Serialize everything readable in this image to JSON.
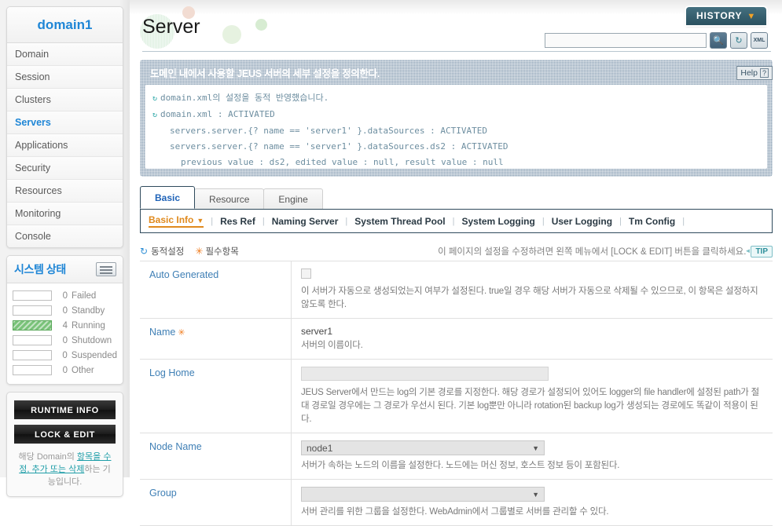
{
  "sidebar": {
    "domain_title": "domain1",
    "nav_items": [
      {
        "label": "Domain",
        "active": false
      },
      {
        "label": "Session",
        "active": false
      },
      {
        "label": "Clusters",
        "active": false
      },
      {
        "label": "Servers",
        "active": true
      },
      {
        "label": "Applications",
        "active": false
      },
      {
        "label": "Security",
        "active": false
      },
      {
        "label": "Resources",
        "active": false
      },
      {
        "label": "Monitoring",
        "active": false
      },
      {
        "label": "Console",
        "active": false
      }
    ],
    "status": {
      "title": "시스템 상태",
      "icon": "monitor-icon",
      "rows": [
        {
          "count": "0",
          "label": "Failed",
          "filled": false
        },
        {
          "count": "0",
          "label": "Standby",
          "filled": false
        },
        {
          "count": "4",
          "label": "Running",
          "filled": true
        },
        {
          "count": "0",
          "label": "Shutdown",
          "filled": false
        },
        {
          "count": "0",
          "label": "Suspended",
          "filled": false
        },
        {
          "count": "0",
          "label": "Other",
          "filled": false
        }
      ],
      "fill_color": "#79c279"
    },
    "buttons": {
      "runtime_info": "RUNTIME INFO",
      "lock_and_edit": "LOCK & EDIT"
    },
    "hint_prefix": "해당 Domain의 ",
    "hint_link": "항목을 수정, 추가 또는 삭제",
    "hint_suffix": "하는 기능입니다."
  },
  "header": {
    "page_title": "Server",
    "history_label": "HISTORY",
    "history_caret": "▼",
    "search_value": "",
    "search_placeholder": "",
    "icons": [
      "search-icon",
      "sync-icon",
      "xml-export-icon"
    ],
    "xml_icon_text": "XML"
  },
  "message_panel": {
    "title": "도메인 내에서 사용할 JEUS 서버의 세부 설정을 정의한다.",
    "help_label": "Help",
    "help_mark": "?",
    "lines": [
      {
        "icon": "sync-icon",
        "text": "domain.xml의 설정을 동적 반영했습니다.",
        "indent": 0
      },
      {
        "icon": "sync-icon",
        "text": "domain.xml : ACTIVATED",
        "indent": 0
      },
      {
        "icon": "",
        "text": "servers.server.{? name == 'server1' }.dataSources : ACTIVATED",
        "indent": 1
      },
      {
        "icon": "",
        "text": "servers.server.{? name == 'server1' }.dataSources.ds2 : ACTIVATED",
        "indent": 1
      },
      {
        "icon": "",
        "text": "previous value : ds2, edited value : null, result value : null",
        "indent": 2
      }
    ]
  },
  "tabs": {
    "main": [
      {
        "label": "Basic",
        "active": true
      },
      {
        "label": "Resource",
        "active": false
      },
      {
        "label": "Engine",
        "active": false
      }
    ],
    "sub": [
      {
        "label": "Basic Info",
        "active": true,
        "caret": "▼"
      },
      {
        "label": "Res Ref",
        "active": false
      },
      {
        "label": "Naming Server",
        "active": false
      },
      {
        "label": "System Thread Pool",
        "active": false
      },
      {
        "label": "System Logging",
        "active": false
      },
      {
        "label": "User Logging",
        "active": false
      },
      {
        "label": "Tm Config",
        "active": false
      }
    ]
  },
  "legend": {
    "dynamic_icon": "sync-icon",
    "dynamic_label": "동적설정",
    "required_icon": "asterisk-icon",
    "required_label": "필수항목",
    "note": "이 페이지의 설정을 수정하려면 왼쪽 메뉴에서 [LOCK & EDIT] 버튼을 클릭하세요.",
    "tip_label": "TIP"
  },
  "form": {
    "rows": [
      {
        "label": "Auto Generated",
        "required": false,
        "control": "checkbox",
        "value": "",
        "checked": false,
        "desc": "이 서버가 자동으로 생성되었는지 여부가 설정된다. true일 경우 해당 서버가 자동으로 삭제될 수 있으므로, 이 항목은 설정하지 않도록 한다."
      },
      {
        "label": "Name",
        "required": true,
        "required_mark": "✳",
        "control": "text-readonly",
        "value": "server1",
        "desc": "서버의 이름이다."
      },
      {
        "label": "Log Home",
        "required": false,
        "control": "textbox",
        "value": "",
        "desc": "JEUS Server에서 만드는 log의 기본 경로를 지정한다. 해당 경로가 설정되어 있어도 logger의 file handler에 설정된 path가 절대 경로일 경우에는 그 경로가 우선시 된다. 기본 log뿐만 아니라 rotation된 backup log가 생성되는 경로에도 똑같이 적용이 된다."
      },
      {
        "label": "Node Name",
        "required": false,
        "control": "select",
        "value": "node1",
        "caret": "▼",
        "desc": "서버가 속하는 노드의 이름을 설정한다. 노드에는 머신 정보, 호스트 정보 등이 포함된다."
      },
      {
        "label": "Group",
        "required": false,
        "control": "select",
        "value": "",
        "caret": "▼",
        "desc": "서버 관리를 위한 그룹을 설정한다. WebAdmin에서 그룹별로 서버를 관리할 수 있다."
      }
    ]
  },
  "colors": {
    "accent_blue": "#1f86d6",
    "label_blue": "#3f7fb5",
    "orange": "#e08a1e",
    "panel_slate": "#93a7ba",
    "running_green": "#79c279"
  }
}
